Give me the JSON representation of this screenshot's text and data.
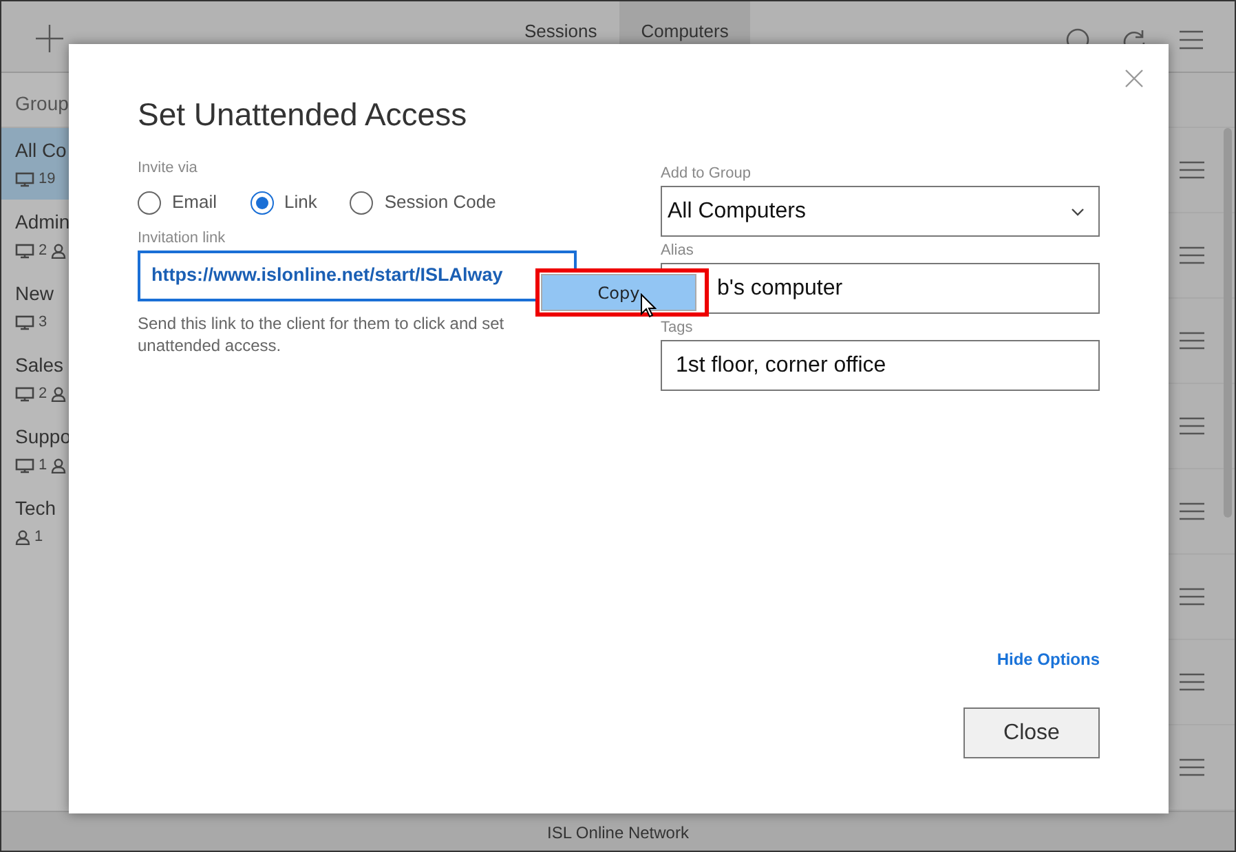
{
  "top_bar": {
    "tabs": [
      {
        "label": "Sessions",
        "selected": false
      },
      {
        "label": "Computers",
        "selected": true
      }
    ]
  },
  "sidebar": {
    "header": "Group",
    "groups": [
      {
        "name": "All Co",
        "selected": true,
        "counts": [
          {
            "kind": "computer",
            "value": "19"
          }
        ]
      },
      {
        "name": "Admin",
        "selected": false,
        "counts": [
          {
            "kind": "computer",
            "value": "2"
          },
          {
            "kind": "user"
          }
        ]
      },
      {
        "name": "New",
        "selected": false,
        "counts": [
          {
            "kind": "computer",
            "value": "3"
          }
        ]
      },
      {
        "name": "Sales",
        "selected": false,
        "counts": [
          {
            "kind": "computer",
            "value": "2"
          },
          {
            "kind": "user"
          }
        ]
      },
      {
        "name": "Suppo",
        "selected": false,
        "counts": [
          {
            "kind": "computer",
            "value": "1"
          },
          {
            "kind": "user"
          }
        ]
      },
      {
        "name": "Tech",
        "selected": false,
        "counts": [
          {
            "kind": "user",
            "value": "1"
          }
        ]
      }
    ]
  },
  "dialog": {
    "title": "Set Unattended Access",
    "invite_via": {
      "label": "Invite via",
      "options": [
        {
          "label": "Email",
          "selected": false
        },
        {
          "label": "Link",
          "selected": true
        },
        {
          "label": "Session Code",
          "selected": false
        }
      ]
    },
    "invitation_link": {
      "label": "Invitation link",
      "value": "https://www.islonline.net/start/ISLAlway"
    },
    "hint": "Send this link to the client for them to click and set unattended access.",
    "add_to_group": {
      "label": "Add to Group",
      "value": "All Computers"
    },
    "alias": {
      "label": "Alias",
      "value": "b's computer"
    },
    "tags": {
      "label": "Tags",
      "value": "1st floor, corner office"
    },
    "hide_options": "Hide Options",
    "close_button": "Close",
    "context_menu": {
      "items": [
        "Copy"
      ]
    }
  },
  "status_bar": "ISL Online Network"
}
